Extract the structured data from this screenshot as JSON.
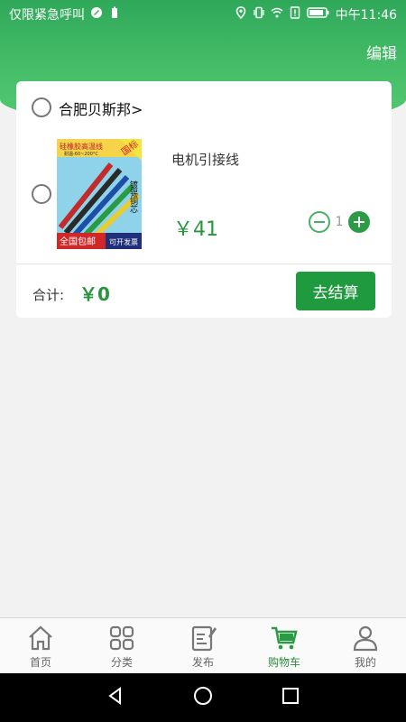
{
  "status_bar": {
    "carrier_text": "仅限紧急呼叫",
    "time": "中午11:46"
  },
  "header": {
    "edit_label": "编辑",
    "accent_color": "#3db35f"
  },
  "cart": {
    "store_name": "合肥贝斯邦>",
    "items": [
      {
        "title": "电机引接线",
        "price": "￥41",
        "quantity": "1",
        "image_texts": {
          "title": "硅橡胶高温线",
          "range": "耐温-60~200°C",
          "badge": "国标",
          "side": "镀锡铜芯",
          "bottom_left": "全国包邮",
          "bottom_right": "可开发票"
        }
      }
    ],
    "total_label": "合计:",
    "total_value": "￥0",
    "checkout_label": "去结算"
  },
  "tabbar": {
    "tabs": [
      {
        "label": "首页",
        "icon": "home-icon"
      },
      {
        "label": "分类",
        "icon": "grid-icon"
      },
      {
        "label": "发布",
        "icon": "edit-icon"
      },
      {
        "label": "购物车",
        "icon": "cart-icon",
        "active": true
      },
      {
        "label": "我的",
        "icon": "user-icon"
      }
    ]
  }
}
